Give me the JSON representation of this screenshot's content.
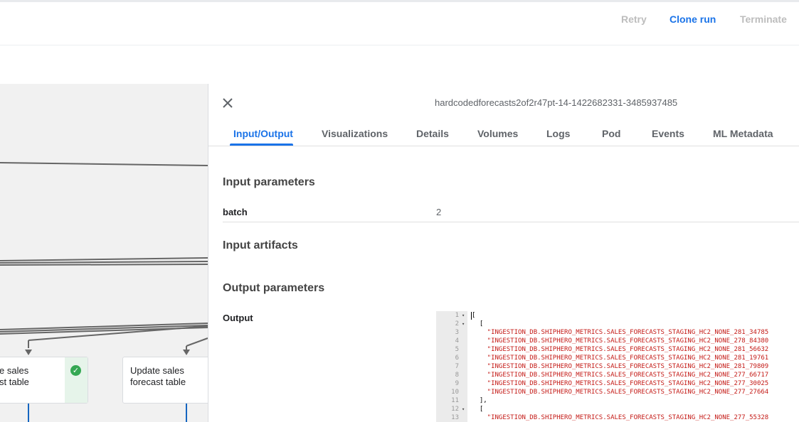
{
  "top_actions": {
    "retry": "Retry",
    "clone_run": "Clone run",
    "terminate": "Terminate"
  },
  "graph": {
    "nodes": [
      {
        "label_line1": "e sales",
        "label_line2": "st table",
        "status": "succeeded"
      },
      {
        "label_line1": "Update sales",
        "label_line2": "forecast table"
      }
    ]
  },
  "panel": {
    "title": "hardcodedforecasts2of2r47pt-14-1422682331-3485937485",
    "tabs": [
      "Input/Output",
      "Visualizations",
      "Details",
      "Volumes",
      "Logs",
      "Pod",
      "Events",
      "ML Metadata"
    ],
    "active_tab": "Input/Output",
    "input_parameters": {
      "heading": "Input parameters",
      "rows": [
        {
          "name": "batch",
          "value": "2"
        }
      ]
    },
    "input_artifacts": {
      "heading": "Input artifacts"
    },
    "output_parameters": {
      "heading": "Output parameters",
      "rows": [
        {
          "name": "Output"
        }
      ]
    },
    "editor": {
      "lines": [
        {
          "n": "1",
          "fold": "▾",
          "text": "["
        },
        {
          "n": "2",
          "fold": "▾",
          "text": "  ["
        },
        {
          "n": "3",
          "fold": "",
          "text": "    \"INGESTION_DB.SHIPHERO_METRICS.SALES_FORECASTS_STAGING_HC2_NONE_281_34785"
        },
        {
          "n": "4",
          "fold": "",
          "text": "    \"INGESTION_DB.SHIPHERO_METRICS.SALES_FORECASTS_STAGING_HC2_NONE_278_84380"
        },
        {
          "n": "5",
          "fold": "",
          "text": "    \"INGESTION_DB.SHIPHERO_METRICS.SALES_FORECASTS_STAGING_HC2_NONE_281_56632"
        },
        {
          "n": "6",
          "fold": "",
          "text": "    \"INGESTION_DB.SHIPHERO_METRICS.SALES_FORECASTS_STAGING_HC2_NONE_281_19761"
        },
        {
          "n": "7",
          "fold": "",
          "text": "    \"INGESTION_DB.SHIPHERO_METRICS.SALES_FORECASTS_STAGING_HC2_NONE_281_79809"
        },
        {
          "n": "8",
          "fold": "",
          "text": "    \"INGESTION_DB.SHIPHERO_METRICS.SALES_FORECASTS_STAGING_HC2_NONE_277_66717"
        },
        {
          "n": "9",
          "fold": "",
          "text": "    \"INGESTION_DB.SHIPHERO_METRICS.SALES_FORECASTS_STAGING_HC2_NONE_277_30025"
        },
        {
          "n": "10",
          "fold": "",
          "text": "    \"INGESTION_DB.SHIPHERO_METRICS.SALES_FORECASTS_STAGING_HC2_NONE_277_27664"
        },
        {
          "n": "11",
          "fold": "",
          "text": "  ],"
        },
        {
          "n": "12",
          "fold": "▾",
          "text": "  ["
        },
        {
          "n": "13",
          "fold": "",
          "text": "    \"INGESTION_DB.SHIPHERO_METRICS.SALES_FORECASTS_STAGING_HC2_NONE_277_55328"
        }
      ]
    }
  },
  "colors": {
    "accent": "#1a73e8",
    "success": "#34a853",
    "string": "#c41a16"
  },
  "icons": {
    "close": "close-icon",
    "status": "check-circle-icon"
  }
}
